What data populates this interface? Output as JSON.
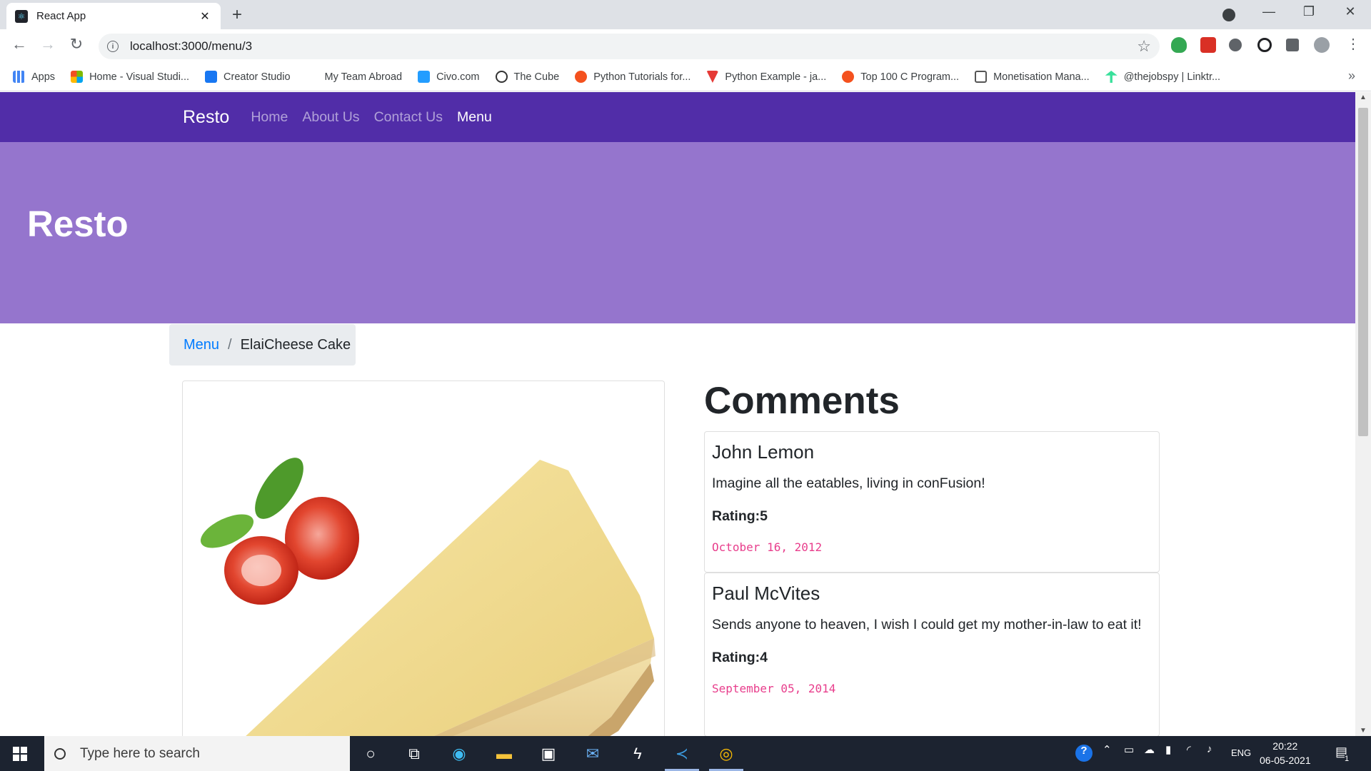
{
  "browser": {
    "tab_title": "React App",
    "tab_close": "✕",
    "new_tab": "+",
    "url": "localhost:3000/menu/3"
  },
  "bookmarks": [
    {
      "label": "Apps",
      "color": "#4285f4"
    },
    {
      "label": "Home - Visual Studi...",
      "color": "#f25022"
    },
    {
      "label": "Creator Studio",
      "color": "#1877f2"
    },
    {
      "label": "My Team Abroad",
      "color": "#ffffff"
    },
    {
      "label": "Civo.com",
      "color": "#239dff"
    },
    {
      "label": "The Cube",
      "color": "#333333"
    },
    {
      "label": "Python Tutorials for...",
      "color": "#f4511e"
    },
    {
      "label": "Python Example - ja...",
      "color": "#e53935"
    },
    {
      "label": "Top 100 C Program...",
      "color": "#f4511e"
    },
    {
      "label": "Monetisation Mana...",
      "color": "#555555"
    },
    {
      "label": "@thejobspy | Linktr...",
      "color": "#39e09b"
    }
  ],
  "navbar": {
    "brand": "Resto",
    "links": [
      "Home",
      "About Us",
      "Contact Us",
      "Menu"
    ],
    "active": "Menu",
    "color": "#512da8"
  },
  "jumbotron": {
    "title": "Resto",
    "color": "#9575cd"
  },
  "breadcrumb": {
    "parent": "Menu",
    "separator": "/",
    "current": "ElaiCheese Cake"
  },
  "dish": {
    "image_alt": "ElaiCheese Cake"
  },
  "comments": {
    "heading": "Comments",
    "items": [
      {
        "author": "John Lemon",
        "text": "Imagine all the eatables, living in conFusion!",
        "rating": "Rating:5",
        "date": "October 16, 2012"
      },
      {
        "author": "Paul McVites",
        "text": "Sends anyone to heaven, I wish I could get my mother-in-law to eat it!",
        "rating": "Rating:4",
        "date": "September 05, 2014"
      }
    ]
  },
  "taskbar": {
    "search_placeholder": "Type here to search",
    "language": "ENG",
    "time": "20:22",
    "date": "06-05-2021",
    "notification_count": "1"
  }
}
